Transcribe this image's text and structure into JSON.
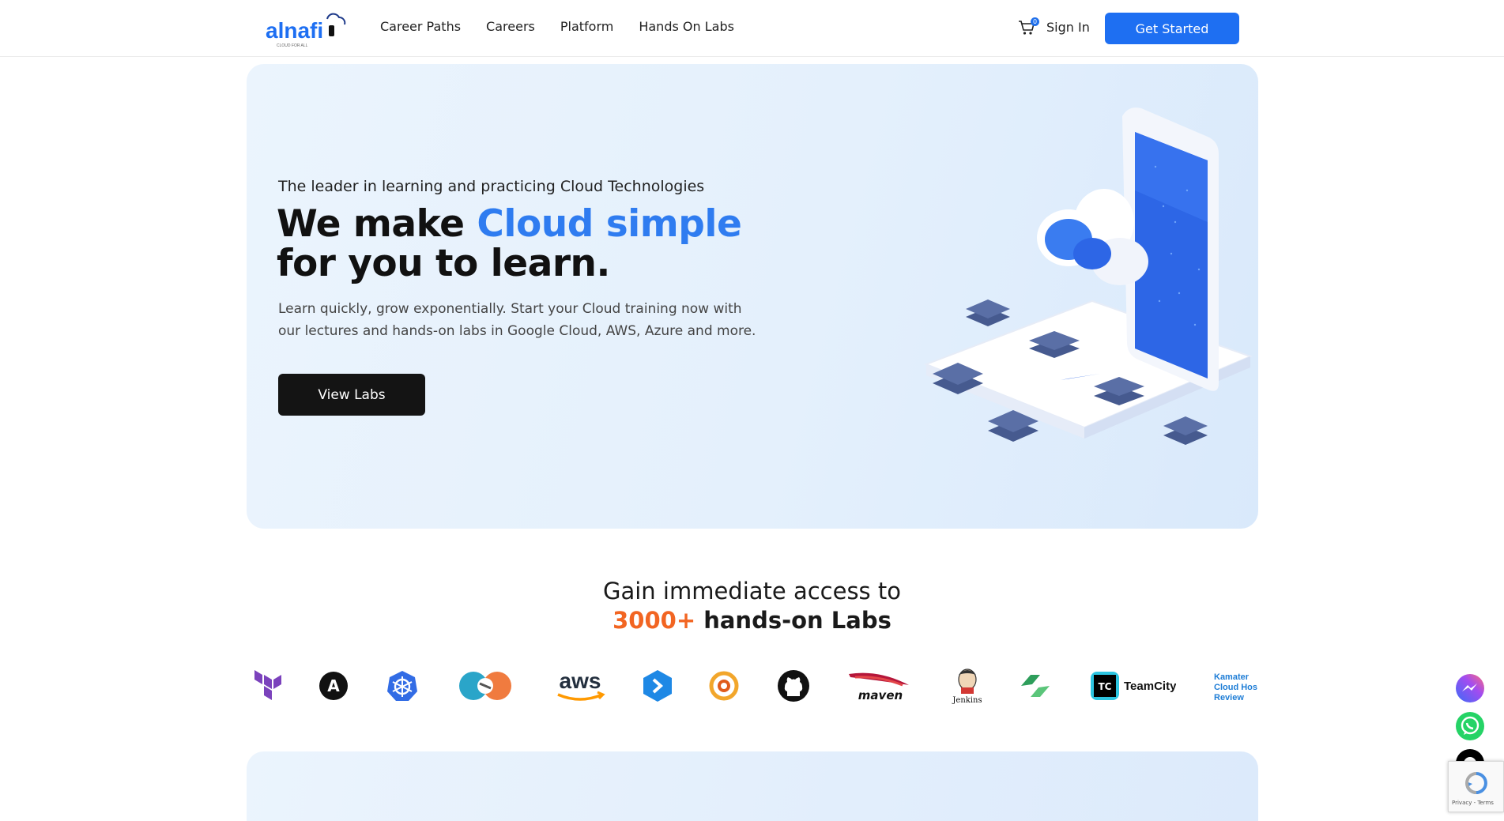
{
  "nav": {
    "brand": "alnafi",
    "brand_tagline": "CLOUD FOR ALL",
    "links": [
      {
        "label": "Career Paths"
      },
      {
        "label": "Careers"
      },
      {
        "label": "Platform"
      },
      {
        "label": "Hands On Labs"
      }
    ],
    "cart_count": "0",
    "signin_label": "Sign In",
    "cta_label": "Get Started"
  },
  "hero": {
    "eyebrow": "The leader in learning and practicing Cloud Technologies",
    "headline_part1": "We make ",
    "headline_accent": "Cloud simple",
    "headline_part2": "for you to learn.",
    "subtext": "Learn quickly, grow exponentially. Start your Cloud training now with our lectures and hands-on labs in Google Cloud, AWS, Azure and more.",
    "cta_label": "View Labs"
  },
  "labs_section": {
    "line1": "Gain immediate access to",
    "count": "3000+",
    "line2_rest": " hands-on Labs"
  },
  "tech_logos": [
    {
      "name": "Terraform",
      "icon": "terraform-icon"
    },
    {
      "name": "Ansible",
      "icon": "ansible-icon",
      "text": "A"
    },
    {
      "name": "Kubernetes",
      "icon": "kubernetes-icon"
    },
    {
      "name": "Istio / Cloud",
      "icon": "cloud-sync-icon"
    },
    {
      "name": "AWS",
      "icon": "aws-icon",
      "text": "aws"
    },
    {
      "name": "Azure DevOps",
      "icon": "azure-devops-icon"
    },
    {
      "name": "Grafana",
      "icon": "grafana-icon"
    },
    {
      "name": "GitHub",
      "icon": "github-icon"
    },
    {
      "name": "Maven",
      "icon": "maven-icon",
      "text": "maven"
    },
    {
      "name": "Jenkins",
      "icon": "jenkins-icon",
      "text": "Jenkins"
    },
    {
      "name": "Sync",
      "icon": "sync-icon"
    },
    {
      "name": "TeamCity",
      "icon": "teamcity-icon",
      "text": "TeamCity",
      "badge": "TC"
    },
    {
      "name": "Kamatera",
      "icon": "kamatera-icon",
      "text_lines": [
        "Kamater",
        "Cloud Hos",
        "Review"
      ]
    }
  ],
  "widgets": {
    "recaptcha_text": "Privacy - Terms"
  },
  "colors": {
    "primary": "#1e6ff2",
    "accent_blue": "#2f7cf0",
    "accent_orange": "#f26522",
    "dark": "#141414"
  }
}
